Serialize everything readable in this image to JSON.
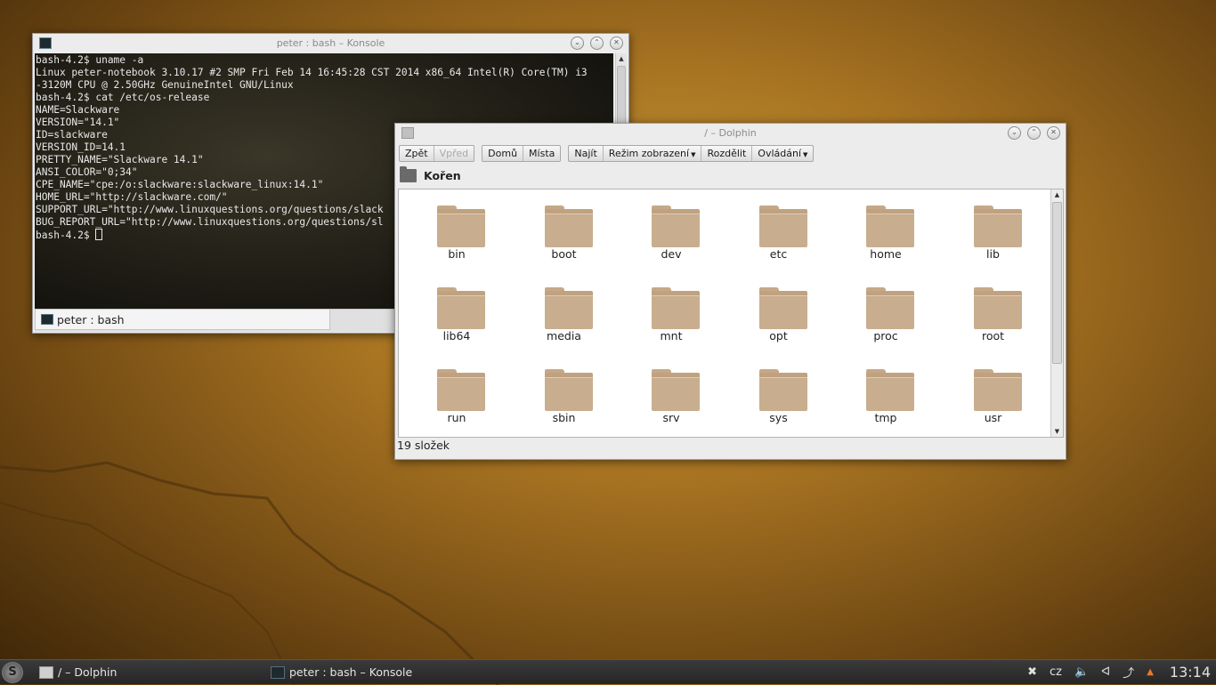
{
  "konsole": {
    "title": "peter : bash – Konsole",
    "lines": [
      "bash-4.2$ uname -a",
      "Linux peter-notebook 3.10.17 #2 SMP Fri Feb 14 16:45:28 CST 2014 x86_64 Intel(R) Core(TM) i3",
      "-3120M CPU @ 2.50GHz GenuineIntel GNU/Linux",
      "bash-4.2$ cat /etc/os-release",
      "NAME=Slackware",
      "VERSION=\"14.1\"",
      "ID=slackware",
      "VERSION_ID=14.1",
      "PRETTY_NAME=\"Slackware 14.1\"",
      "ANSI_COLOR=\"0;34\"",
      "CPE_NAME=\"cpe:/o:slackware:slackware_linux:14.1\"",
      "HOME_URL=\"http://slackware.com/\"",
      "SUPPORT_URL=\"http://www.linuxquestions.org/questions/slack",
      "BUG_REPORT_URL=\"http://www.linuxquestions.org/questions/sl"
    ],
    "prompt": "bash-4.2$ ",
    "tab_label": "peter : bash"
  },
  "dolphin": {
    "title": "/ – Dolphin",
    "toolbar": {
      "back": "Zpět",
      "forward": "Vpřed",
      "home": "Domů",
      "places": "Místa",
      "find": "Najít",
      "view_mode": "Režim zobrazení",
      "split": "Rozdělit",
      "control": "Ovládání"
    },
    "breadcrumb": "Kořen",
    "folders": [
      "bin",
      "boot",
      "dev",
      "etc",
      "home",
      "lib",
      "lib64",
      "media",
      "mnt",
      "opt",
      "proc",
      "root",
      "run",
      "sbin",
      "srv",
      "sys",
      "tmp",
      "usr"
    ],
    "status": "19 složek"
  },
  "taskbar": {
    "tasks": [
      {
        "label": "/ – Dolphin",
        "icon": "folder-icon"
      },
      {
        "label": "peter : bash – Konsole",
        "icon": "terminal-icon"
      }
    ],
    "keyboard_layout": "cz",
    "clock": "13:14"
  }
}
